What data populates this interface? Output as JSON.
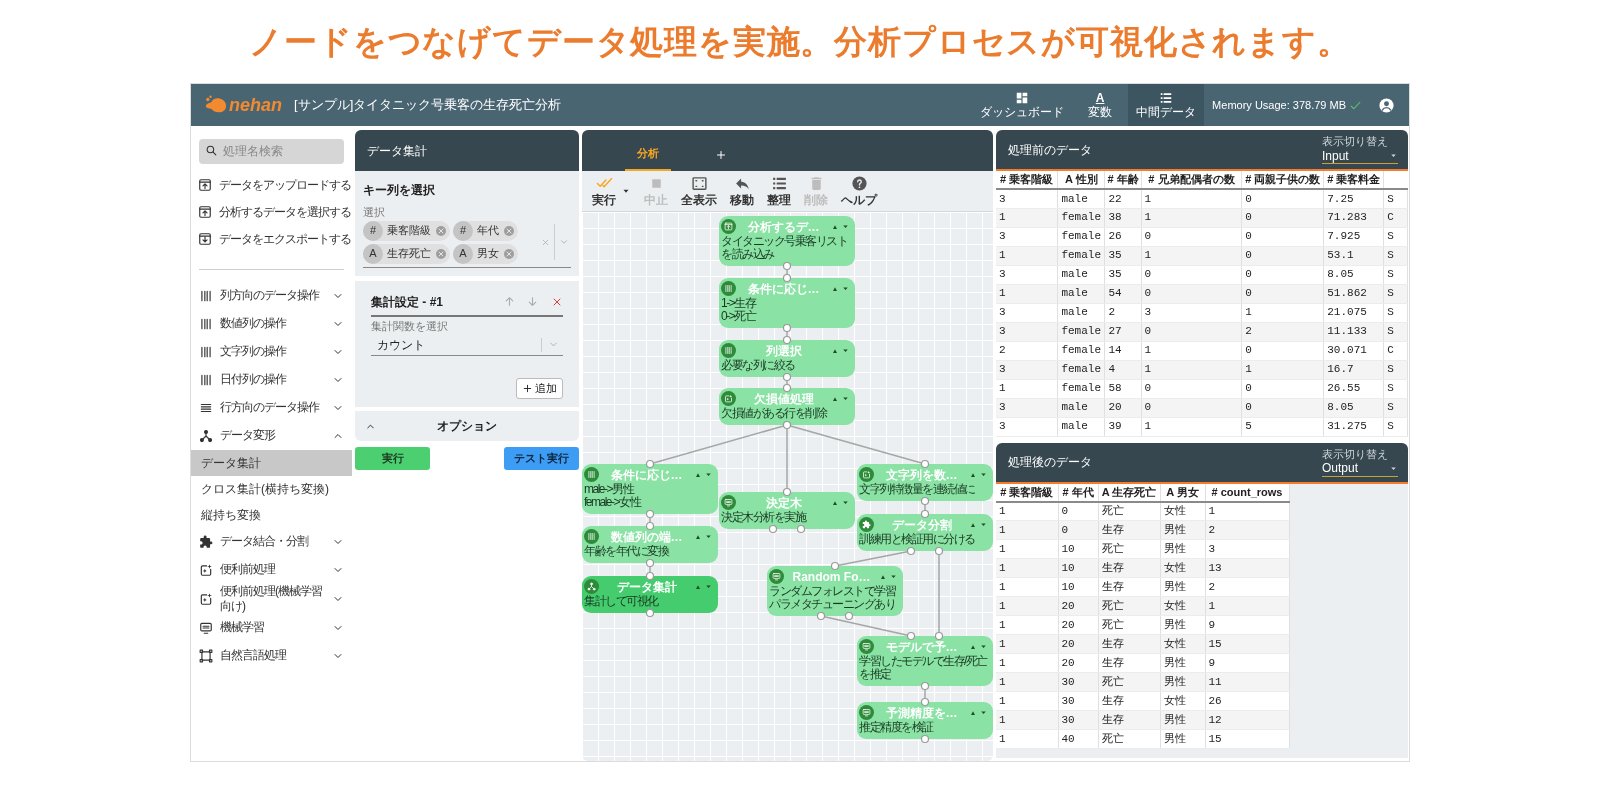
{
  "headline": "ノードをつなげてデータ処理を実施。分析プロセスが可視化されます。",
  "app": {
    "logo": "nehan",
    "title": "[サンプル]タイタニック号乗客の生存死亡分析",
    "nav": [
      {
        "label": "ダッシュボード",
        "kind": "dashboard",
        "selected": false
      },
      {
        "label": "変数",
        "kind": "letter",
        "glyph": "A",
        "selected": false
      },
      {
        "label": "中間データ",
        "kind": "list",
        "selected": true
      }
    ],
    "memory": "Memory Usage: 378.79 MB"
  },
  "sidebar": {
    "search": {
      "placeholder": "処理名検索"
    },
    "actions": [
      {
        "label": "データをアップロードする",
        "kind": "upload"
      },
      {
        "label": "分析するデータを選択する",
        "kind": "upload"
      },
      {
        "label": "データをエクスポートする",
        "kind": "download"
      }
    ],
    "categories": [
      {
        "label": "列方向のデータ操作",
        "kind": "columns",
        "expanded": false
      },
      {
        "label": "数値列の操作",
        "kind": "columns",
        "expanded": false
      },
      {
        "label": "文字列の操作",
        "kind": "columns",
        "expanded": false
      },
      {
        "label": "日付列の操作",
        "kind": "columns",
        "expanded": false
      },
      {
        "label": "行方向のデータ操作",
        "kind": "rows",
        "expanded": false
      },
      {
        "label": "データ変形",
        "kind": "branch",
        "expanded": true,
        "children": [
          {
            "label": "データ集計",
            "selected": true
          },
          {
            "label": "クロス集計(横持ち変換)",
            "selected": false
          },
          {
            "label": "縦持ち変換",
            "selected": false
          }
        ]
      },
      {
        "label": "データ結合・分割",
        "kind": "puzzle",
        "expanded": false
      },
      {
        "label": "便利前処理",
        "kind": "spark",
        "expanded": false
      },
      {
        "label": "便利前処理(機械学習向け)",
        "kind": "spark",
        "expanded": false
      },
      {
        "label": "機械学習",
        "kind": "monitor",
        "expanded": false
      },
      {
        "label": "自然言語処理",
        "kind": "frame",
        "expanded": false
      }
    ]
  },
  "settings": {
    "title": "データ集計",
    "key_section": "キー列を選択",
    "select_label": "選択",
    "chips": [
      {
        "type": "#",
        "label": "乗客階級"
      },
      {
        "type": "#",
        "label": "年代"
      },
      {
        "type": "A",
        "label": "生存死亡"
      },
      {
        "type": "A",
        "label": "男女"
      }
    ],
    "aggregations": [
      {
        "title": "集計設定 - #1",
        "function_label": "集計関数を選択",
        "function": "カウント"
      }
    ],
    "add_button": "追加",
    "options": "オプション",
    "run_button": "実行",
    "test_button": "テスト実行"
  },
  "flow": {
    "tabs": [
      {
        "label": "分析",
        "selected": true
      }
    ],
    "toolbar": [
      {
        "label": "実行",
        "kind": "run",
        "disabled": false,
        "dropdown": true
      },
      {
        "label": "中止",
        "kind": "stop",
        "disabled": true
      },
      {
        "label": "全表示",
        "kind": "fit",
        "disabled": false
      },
      {
        "label": "移動",
        "kind": "move",
        "disabled": false
      },
      {
        "label": "整理",
        "kind": "list",
        "disabled": false
      },
      {
        "label": "削除",
        "kind": "trash",
        "disabled": true
      },
      {
        "label": "ヘルプ",
        "kind": "help",
        "disabled": false
      }
    ],
    "nodes": [
      {
        "title": "分析するデ…",
        "kind": "upload",
        "selected": false,
        "description": [
          "タイタニック号乗客リスト",
          "を読み込み"
        ]
      },
      {
        "title": "条件に応じ…",
        "kind": "columns",
        "selected": false,
        "description": [
          "1->生存",
          "0->死亡"
        ]
      },
      {
        "title": "列選択",
        "kind": "columns",
        "selected": false,
        "description": [
          "必要な列に絞る"
        ]
      },
      {
        "title": "欠損値処理",
        "kind": "spark",
        "selected": false,
        "description": [
          "欠損値がある行を削除"
        ]
      },
      {
        "title": "条件に応じ…",
        "kind": "columns",
        "selected": false,
        "description": [
          "male->男性",
          "female->女性"
        ]
      },
      {
        "title": "数値列の端…",
        "kind": "columns",
        "selected": false,
        "description": [
          "年齢を年代に変換"
        ]
      },
      {
        "title": "データ集計",
        "kind": "branch",
        "selected": true,
        "description": [
          "集計して可視化"
        ]
      },
      {
        "title": "決定木",
        "kind": "monitor",
        "selected": false,
        "description": [
          "決定木分析を実施"
        ]
      },
      {
        "title": "文字列を数…",
        "kind": "spark",
        "selected": false,
        "description": [
          "文字列特徴量を連続値に"
        ]
      },
      {
        "title": "データ分割",
        "kind": "puzzle",
        "selected": false,
        "description": [
          "訓練用と検証用に分ける"
        ]
      },
      {
        "title": "Random Fo…",
        "kind": "monitor",
        "selected": false,
        "description": [
          "ランダムフォレストで学習",
          "パラメタチューニングあり"
        ]
      },
      {
        "title": "モデルで予…",
        "kind": "monitor",
        "selected": false,
        "description": [
          "学習したモデルで生存/死亡",
          "を推定"
        ]
      },
      {
        "title": "予測精度を…",
        "kind": "monitor",
        "selected": false,
        "description": [
          "推定精度を検証"
        ]
      }
    ]
  },
  "before": {
    "title": "処理前のデータ",
    "view_label": "表示切り替え",
    "view": "Input",
    "columns": [
      "# 乗客階級",
      "A 性別",
      "# 年齢",
      "# 兄弟配偶者の数",
      "# 両親子供の数",
      "# 乗客料金"
    ],
    "rows": [
      [
        "3",
        "male",
        "22",
        "1",
        "0",
        "7.25",
        "S"
      ],
      [
        "1",
        "female",
        "38",
        "1",
        "0",
        "71.283",
        "C"
      ],
      [
        "3",
        "female",
        "26",
        "0",
        "0",
        "7.925",
        "S"
      ],
      [
        "1",
        "female",
        "35",
        "1",
        "0",
        "53.1",
        "S"
      ],
      [
        "3",
        "male",
        "35",
        "0",
        "0",
        "8.05",
        "S"
      ],
      [
        "1",
        "male",
        "54",
        "0",
        "0",
        "51.862",
        "S"
      ],
      [
        "3",
        "male",
        "2",
        "3",
        "1",
        "21.075",
        "S"
      ],
      [
        "3",
        "female",
        "27",
        "0",
        "2",
        "11.133",
        "S"
      ],
      [
        "2",
        "female",
        "14",
        "1",
        "0",
        "30.071",
        "C"
      ],
      [
        "3",
        "female",
        "4",
        "1",
        "1",
        "16.7",
        "S"
      ],
      [
        "1",
        "female",
        "58",
        "0",
        "0",
        "26.55",
        "S"
      ],
      [
        "3",
        "male",
        "20",
        "0",
        "0",
        "8.05",
        "S"
      ],
      [
        "3",
        "male",
        "39",
        "1",
        "5",
        "31.275",
        "S"
      ]
    ]
  },
  "after": {
    "title": "処理後のデータ",
    "view_label": "表示切り替え",
    "view": "Output",
    "columns": [
      "# 乗客階級",
      "# 年代",
      "A 生存死亡",
      "A 男女",
      "# count_rows"
    ],
    "rows": [
      [
        "1",
        "0",
        "死亡",
        "女性",
        "1"
      ],
      [
        "1",
        "0",
        "生存",
        "男性",
        "2"
      ],
      [
        "1",
        "10",
        "死亡",
        "男性",
        "3"
      ],
      [
        "1",
        "10",
        "生存",
        "女性",
        "13"
      ],
      [
        "1",
        "10",
        "生存",
        "男性",
        "2"
      ],
      [
        "1",
        "20",
        "死亡",
        "女性",
        "1"
      ],
      [
        "1",
        "20",
        "死亡",
        "男性",
        "9"
      ],
      [
        "1",
        "20",
        "生存",
        "女性",
        "15"
      ],
      [
        "1",
        "20",
        "生存",
        "男性",
        "9"
      ],
      [
        "1",
        "30",
        "死亡",
        "男性",
        "11"
      ],
      [
        "1",
        "30",
        "生存",
        "女性",
        "26"
      ],
      [
        "1",
        "30",
        "生存",
        "男性",
        "12"
      ],
      [
        "1",
        "40",
        "死亡",
        "男性",
        "15"
      ]
    ]
  }
}
